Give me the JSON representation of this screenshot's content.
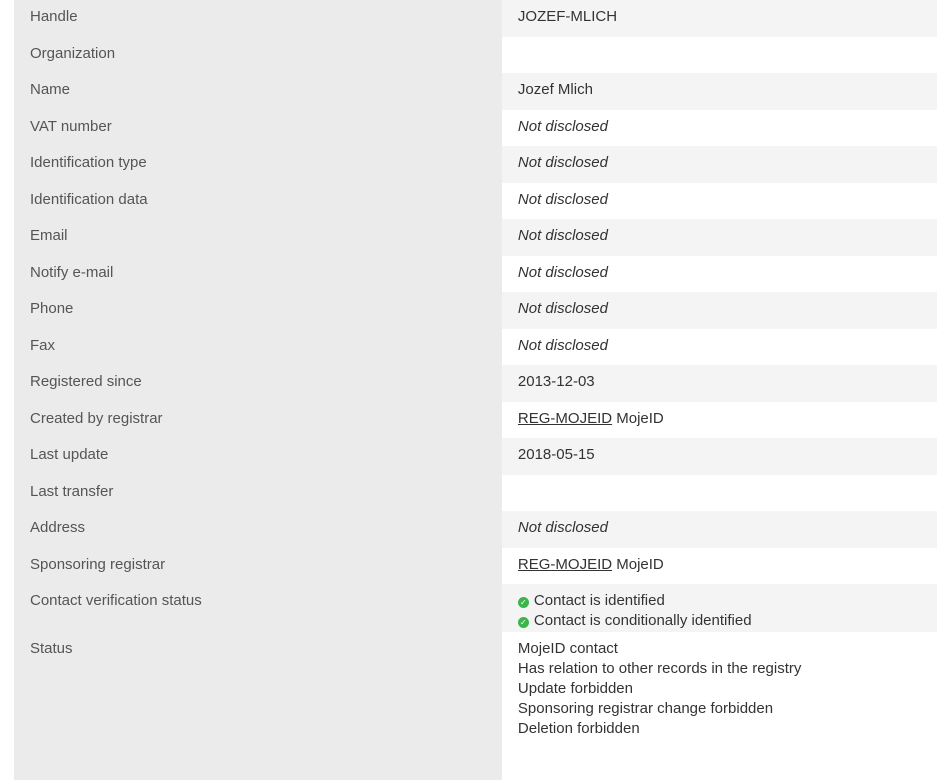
{
  "rows": [
    {
      "label": "Handle",
      "value": "JOZEF-MLICH"
    },
    {
      "label": "Organization",
      "value": ""
    },
    {
      "label": "Name",
      "value": "Jozef Mlich"
    },
    {
      "label": "VAT number",
      "value": "Not disclosed"
    },
    {
      "label": "Identification type",
      "value": "Not disclosed"
    },
    {
      "label": "Identification data",
      "value": "Not disclosed"
    },
    {
      "label": "Email",
      "value": "Not disclosed"
    },
    {
      "label": "Notify e-mail",
      "value": "Not disclosed"
    },
    {
      "label": "Phone",
      "value": "Not disclosed"
    },
    {
      "label": "Fax",
      "value": "Not disclosed"
    },
    {
      "label": "Registered since",
      "value": "2013-12-03"
    },
    {
      "label": "Created by registrar",
      "link": "REG-MOJEID",
      "value": "MojeID"
    },
    {
      "label": "Last update",
      "value": "2018-05-15"
    },
    {
      "label": "Last transfer",
      "value": ""
    },
    {
      "label": "Address",
      "value": "Not disclosed"
    },
    {
      "label": "Sponsoring registrar",
      "link": "REG-MOJEID",
      "value": "MojeID"
    }
  ],
  "verification": {
    "label": "Contact verification status",
    "items": [
      "Contact is identified",
      "Contact is conditionally identified"
    ],
    "icon": "check-circle-icon",
    "icon_color": "#3bb54a"
  },
  "status": {
    "label": "Status",
    "items": [
      "MojeID contact",
      "Has relation to other records in the registry",
      "Update forbidden",
      "Sponsoring registrar change forbidden",
      "Deletion forbidden"
    ]
  }
}
